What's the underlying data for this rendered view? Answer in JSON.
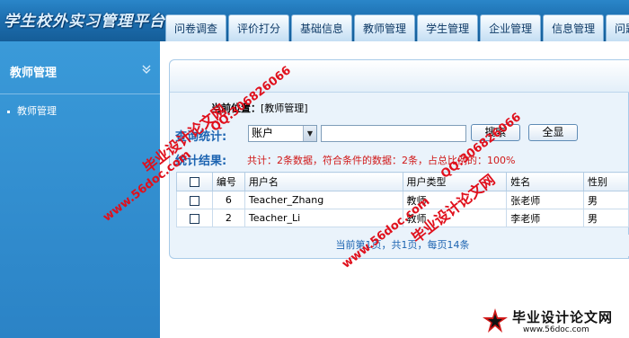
{
  "app": {
    "logo_text": "学生校外实习管理平台"
  },
  "nav": {
    "tabs": [
      {
        "label": "问卷调查"
      },
      {
        "label": "评价打分"
      },
      {
        "label": "基础信息"
      },
      {
        "label": "教师管理"
      },
      {
        "label": "学生管理"
      },
      {
        "label": "企业管理"
      },
      {
        "label": "信息管理"
      },
      {
        "label": "问题答"
      }
    ]
  },
  "sidebar": {
    "title": "教师管理",
    "chevron_icon": "chevron-double-down-icon",
    "items": [
      {
        "label": "教师管理"
      }
    ]
  },
  "breadcrumb": {
    "prefix": "当前位置：",
    "current": "[教师管理]"
  },
  "search": {
    "label": "查询统计:",
    "field_select": "账户",
    "query_value": "",
    "search_button": "搜索",
    "show_all_button": "全显"
  },
  "stats": {
    "label": "统计结果:",
    "text": "共计：2条数据，符合条件的数据：2条，占总比例的：100%"
  },
  "table": {
    "columns": [
      "编号",
      "用户名",
      "用户类型",
      "姓名",
      "性别"
    ],
    "rows": [
      [
        "6",
        "Teacher_Zhang",
        "教师",
        "张老师",
        "男"
      ],
      [
        "2",
        "Teacher_Li",
        "教师",
        "李老师",
        "男"
      ]
    ]
  },
  "pager": {
    "text": "当前第1页，共1页，每页14条"
  },
  "watermarks": {
    "site_name": "毕业设计论文网",
    "url": "www.56doc.com",
    "qq": "QQ:306826066"
  },
  "footer_logo": {
    "title": "毕业设计论文网",
    "url": "www.56doc.com"
  },
  "colors": {
    "header": "#1d6fb0",
    "sidebar": "#2b83c6",
    "accent_blue": "#1c64b1",
    "stat_red": "#d01818",
    "watermark_red": "#e0101c"
  }
}
